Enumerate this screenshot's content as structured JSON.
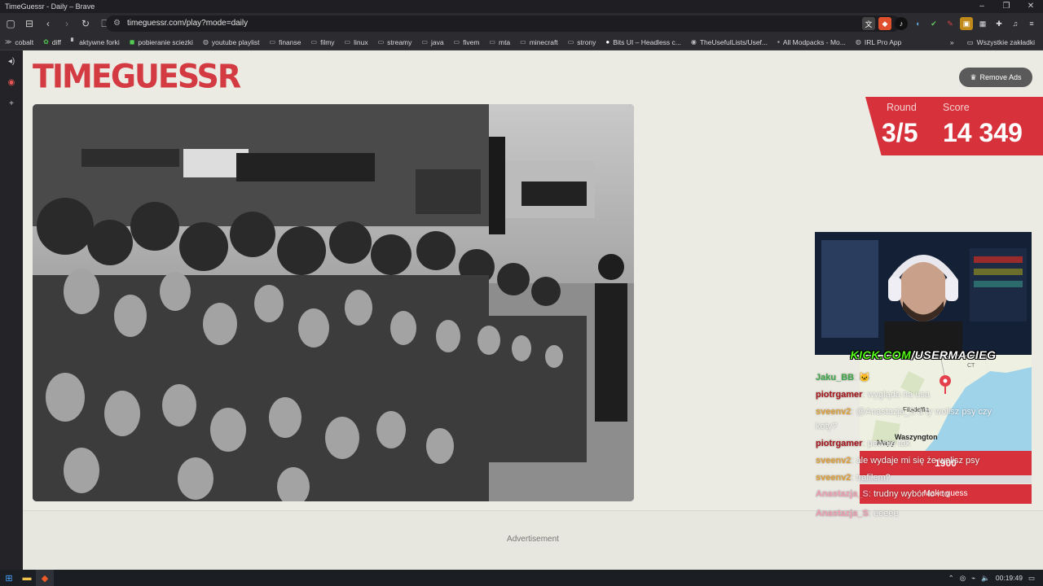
{
  "window": {
    "title": "TimeGuessr - Daily – Brave",
    "controls": [
      "–",
      "❐",
      "✕"
    ]
  },
  "toolbar": {
    "url": "timeguessr.com/play?mode=daily",
    "buttons": [
      "sidebar-toggle",
      "tab-list",
      "back",
      "forward",
      "reload",
      "bookmark"
    ]
  },
  "bookmarks": {
    "items": [
      {
        "label": "cobalt",
        "icon": "cobalt-icon"
      },
      {
        "label": "diff",
        "icon": "diff-icon"
      },
      {
        "label": "aktywne forki",
        "icon": "fork-icon"
      },
      {
        "label": "pobieranie sciezki",
        "icon": "download-icon"
      },
      {
        "label": "youtube playlist",
        "icon": "globe-icon"
      },
      {
        "label": "finanse",
        "icon": "folder-icon"
      },
      {
        "label": "filmy",
        "icon": "folder-icon"
      },
      {
        "label": "linux",
        "icon": "folder-icon"
      },
      {
        "label": "streamy",
        "icon": "folder-icon"
      },
      {
        "label": "java",
        "icon": "folder-icon"
      },
      {
        "label": "fivem",
        "icon": "folder-icon"
      },
      {
        "label": "mta",
        "icon": "folder-icon"
      },
      {
        "label": "minecraft",
        "icon": "folder-icon"
      },
      {
        "label": "strony",
        "icon": "folder-icon"
      },
      {
        "label": "Bits UI – Headless c...",
        "icon": "circle-icon"
      },
      {
        "label": "TheUsefulLists/Usef...",
        "icon": "github-icon"
      },
      {
        "label": "All Modpacks - Mo...",
        "icon": "modpack-icon"
      },
      {
        "label": "IRL Pro App",
        "icon": "globe-icon"
      }
    ],
    "overflow": "»",
    "all_bookmarks": "Wszystkie zakładki"
  },
  "game": {
    "logo": "TIMEGUESSR",
    "remove_ads": "Remove Ads",
    "round_label": "Round",
    "round_value": "3/5",
    "score_label": "Score",
    "score_value": "14 349",
    "advertisement": "Advertisement",
    "minimap": {
      "places": [
        "CT",
        "Filadelfia",
        "Waszyngton"
      ],
      "attribution": "Mapy",
      "year": "1900",
      "make_guess": "Make guess"
    }
  },
  "overlay": {
    "kick_prefix": "KICK.COM",
    "kick_suffix": "/USERMACIEG",
    "chat": [
      {
        "user": "Jaku_BB",
        "color": "#3fa64a",
        "msg": "🐱"
      },
      {
        "user": "piotrgamer",
        "color": "#a8141c",
        "msg": "wygląda na usa"
      },
      {
        "user": "sveenv2",
        "color": "#e0a03a",
        "msg": "@Anastazja_S a ty wolisz psy czy"
      },
      {
        "user": "",
        "color": "#e0a03a",
        "msg": "koty?"
      },
      {
        "user": "piotrgamer",
        "color": "#a8141c",
        "msg": "pewnie tak"
      },
      {
        "user": "sveenv2",
        "color": "#e0a03a",
        "msg": "ale wydaje mi się że wolisz psy"
      },
      {
        "user": "sveenv2",
        "color": "#e0a03a",
        "msg": "trafiłem?"
      },
      {
        "user": "Anastazja_S",
        "color": "#f0a0b4",
        "msg": "trudny wybór to i to"
      },
      {
        "user": "Anastazja_S",
        "color": "#f0a0b4",
        "msg": "eeeee"
      }
    ]
  },
  "taskbar": {
    "time": "00:19:49"
  }
}
